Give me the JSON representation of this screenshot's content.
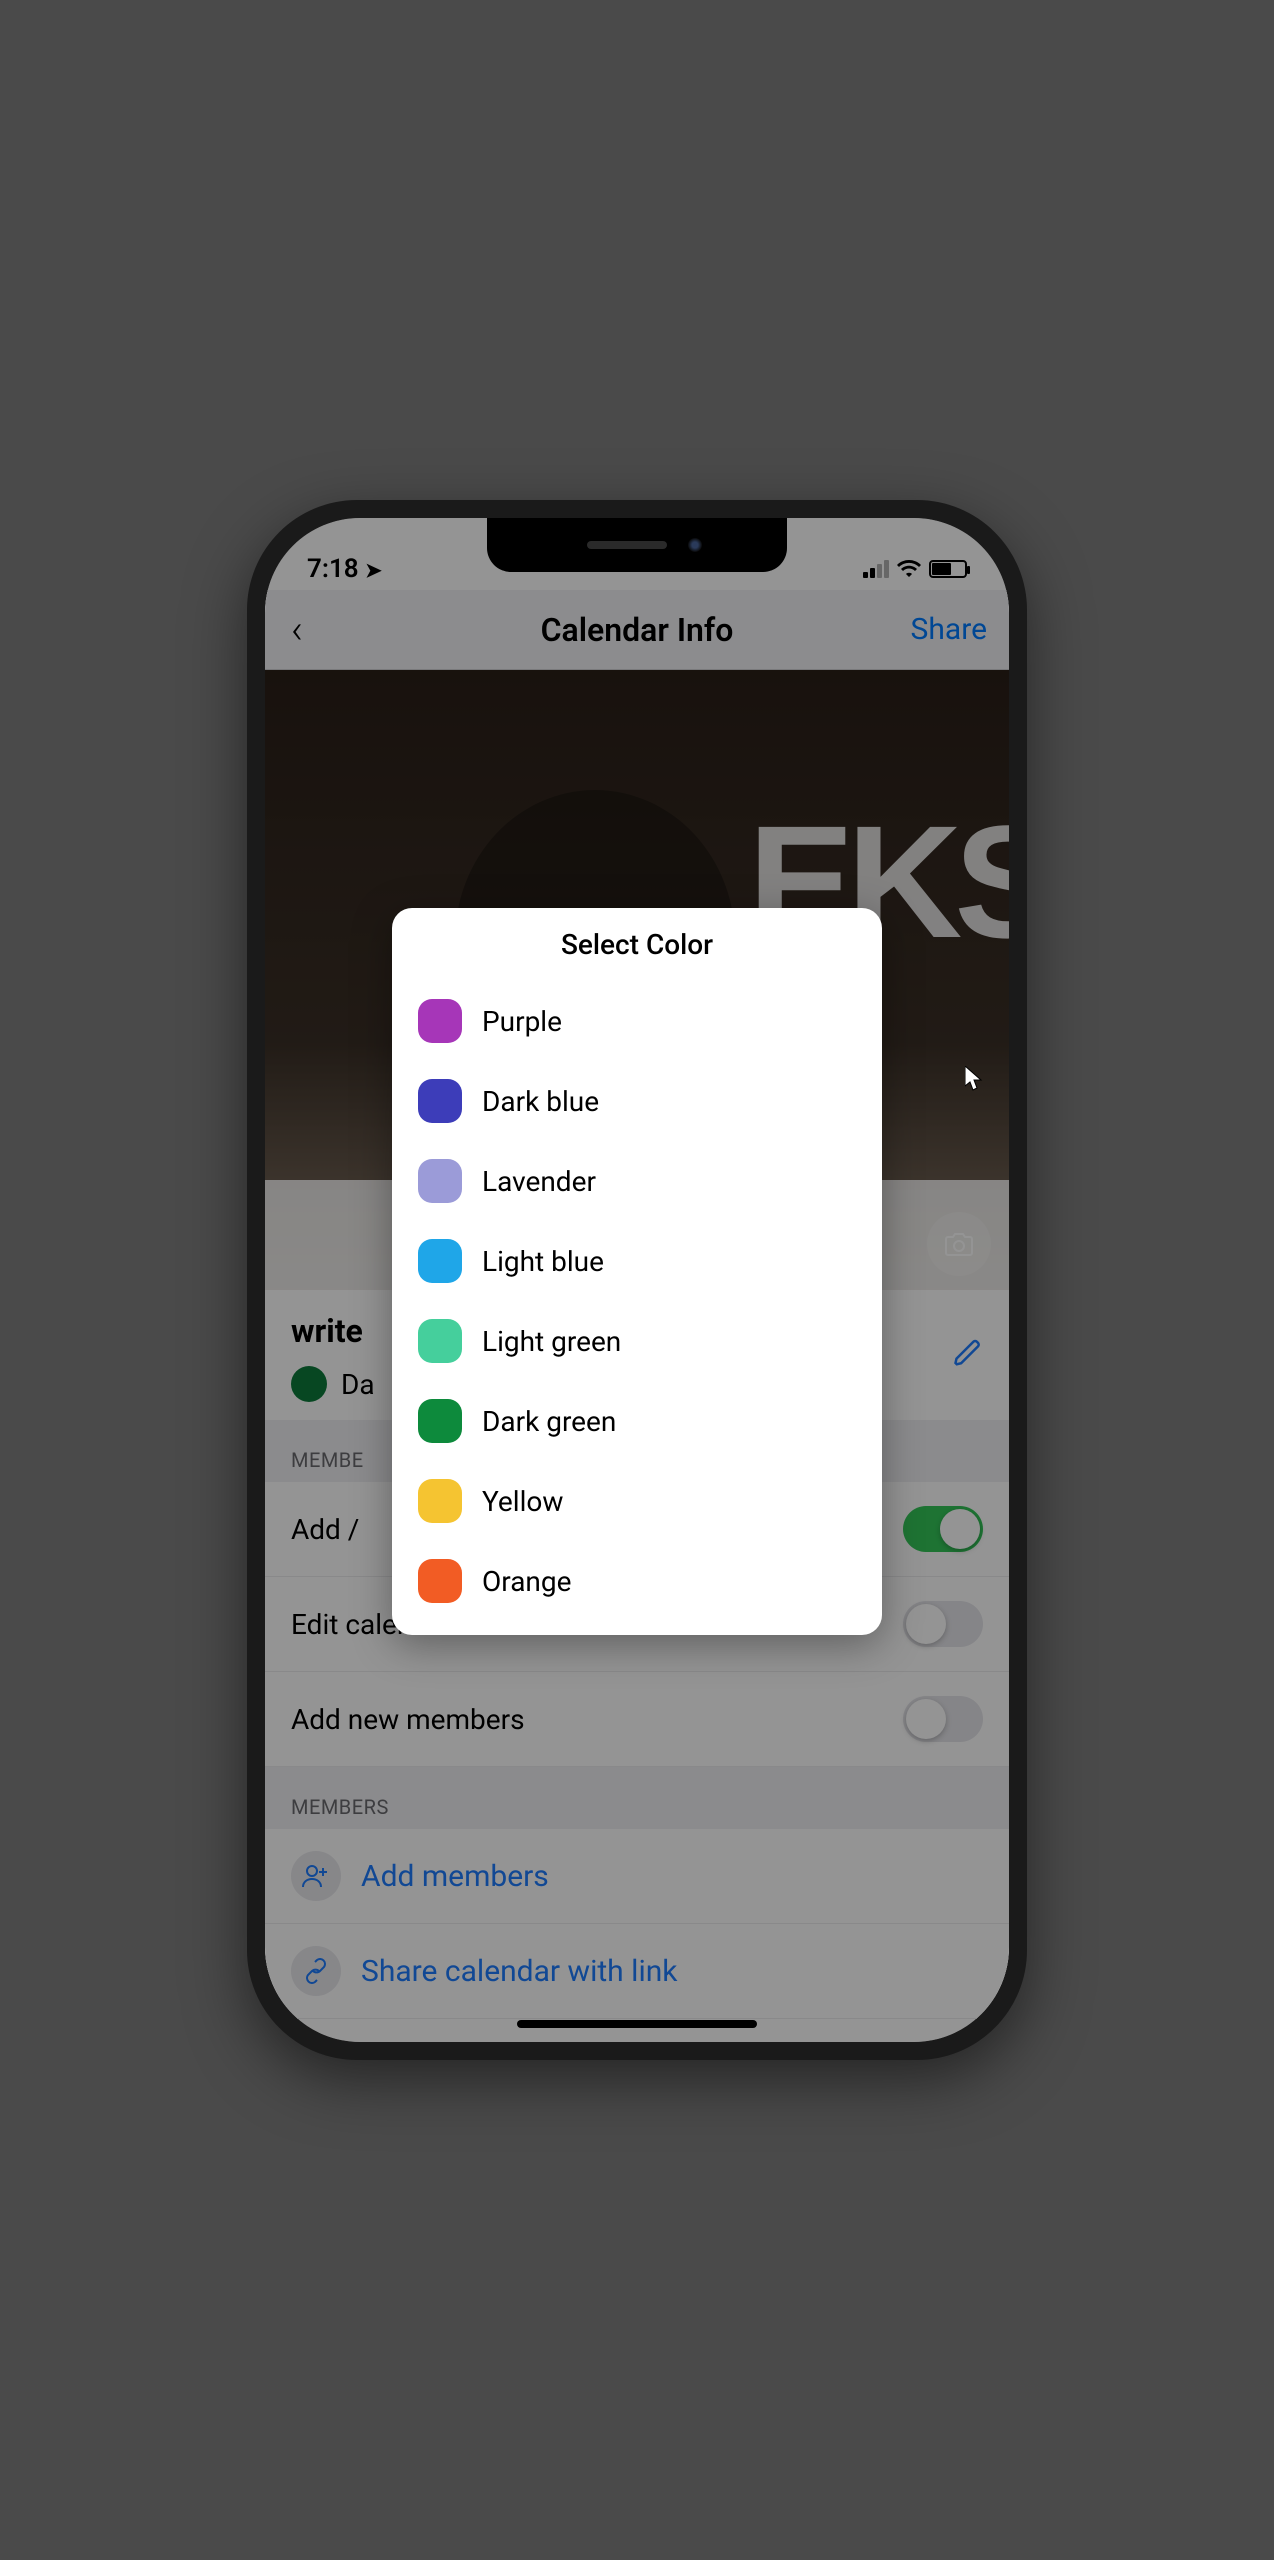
{
  "status": {
    "time": "7:18",
    "location_icon": "➤"
  },
  "nav": {
    "title": "Calendar Info",
    "share": "Share"
  },
  "hero": {
    "partial_text": "EKS"
  },
  "calendar": {
    "name_partial": "write",
    "current_color_label_partial": "Da",
    "current_color": "#0d7a3c"
  },
  "perm_section": "MEMBE",
  "perms": [
    {
      "label": "Add /",
      "on": true
    },
    {
      "label": "Edit calendar name & color",
      "on": false
    },
    {
      "label": "Add new members",
      "on": false
    }
  ],
  "members_section": "MEMBERS",
  "member_links": [
    {
      "label": "Add members"
    },
    {
      "label": "Share calendar with link"
    }
  ],
  "modal": {
    "title": "Select Color",
    "options": [
      {
        "label": "Purple",
        "color": "#a636b8"
      },
      {
        "label": "Dark blue",
        "color": "#3d3db9"
      },
      {
        "label": "Lavender",
        "color": "#9b9bd8"
      },
      {
        "label": "Light blue",
        "color": "#1fa6e8"
      },
      {
        "label": "Light green",
        "color": "#45cf9c"
      },
      {
        "label": "Dark green",
        "color": "#0d8a3c"
      },
      {
        "label": "Yellow",
        "color": "#f5c431"
      },
      {
        "label": "Orange",
        "color": "#f25c24"
      }
    ]
  }
}
